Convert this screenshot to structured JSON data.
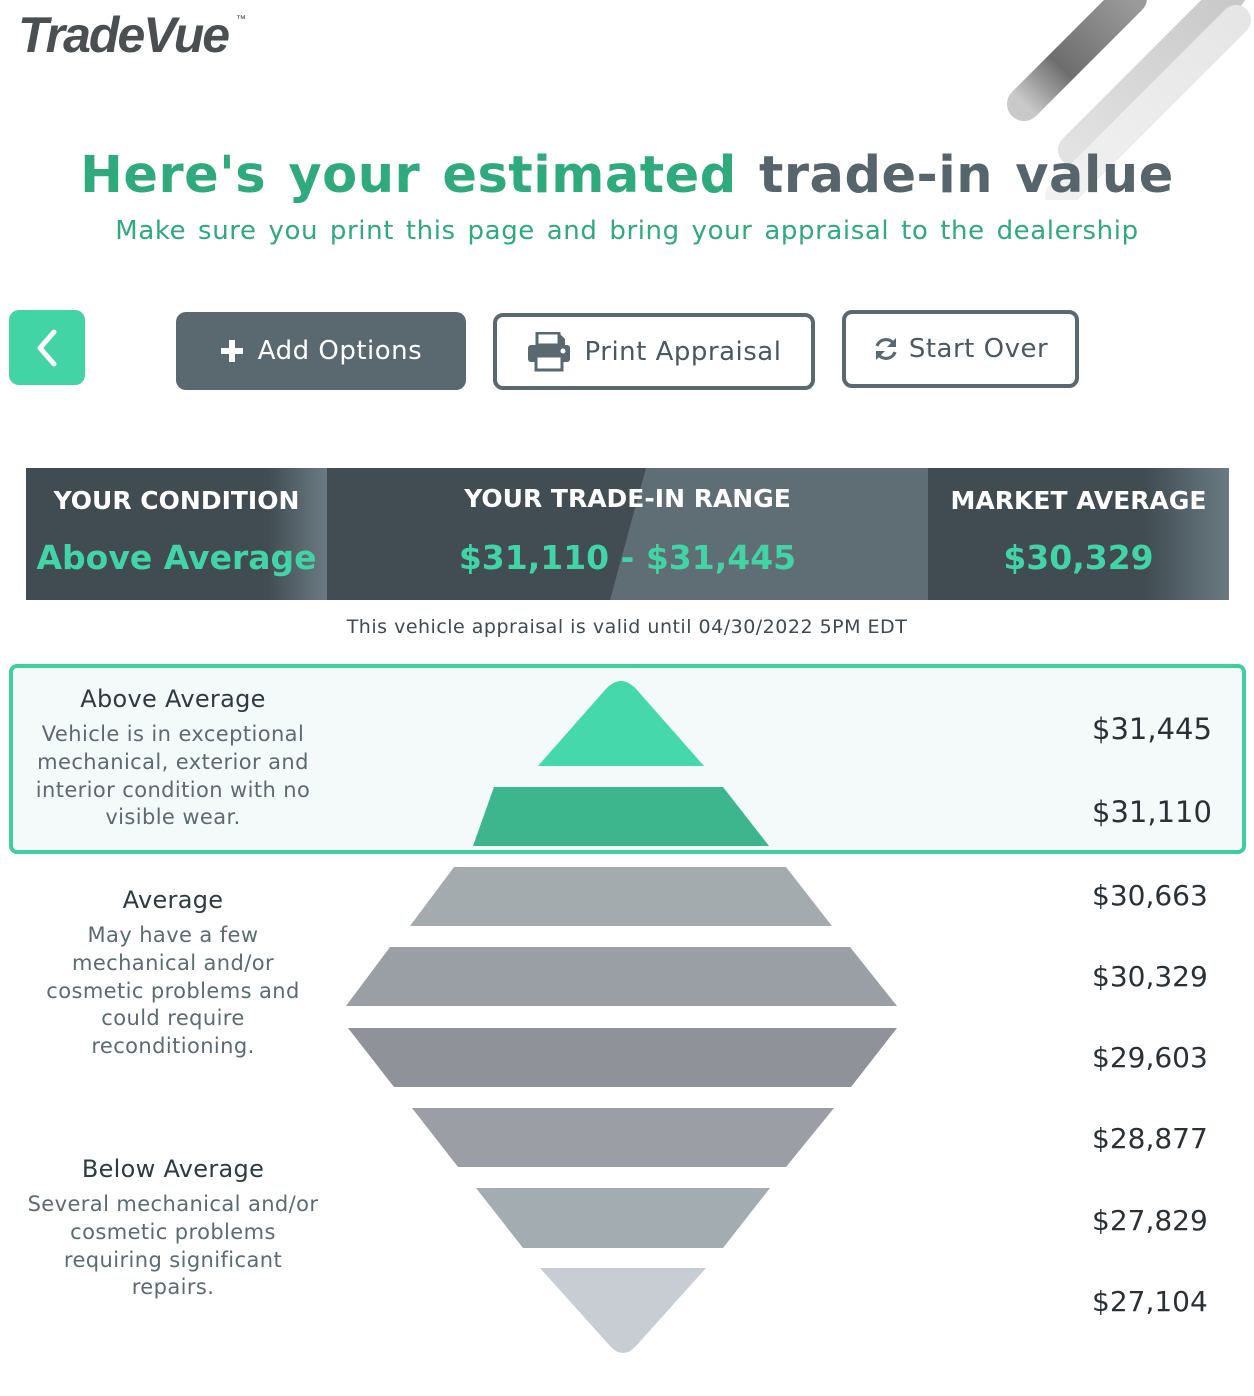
{
  "brand": {
    "logo_text": "TradeVue",
    "tm": "™"
  },
  "header": {
    "title_green": "Here's your estimated",
    "title_dark": "trade-in value",
    "subtitle": "Make sure you print this page and bring your appraisal to the dealership"
  },
  "actions": {
    "add_options": "Add Options",
    "print_appraisal": "Print Appraisal",
    "start_over": "Start Over"
  },
  "summary": {
    "condition_label": "YOUR CONDITION",
    "condition_value": "Above Average",
    "range_label": "YOUR TRADE-IN RANGE",
    "range_value": "$31,110 - $31,445",
    "market_label": "MARKET AVERAGE",
    "market_value": "$30,329"
  },
  "validity": "This vehicle appraisal is valid until 04/30/2022 5PM EDT",
  "conditions": [
    {
      "title": "Above Average",
      "description": "Vehicle is in exceptional mechanical, exterior and interior condition with no visible wear."
    },
    {
      "title": "Average",
      "description": "May have a few mechanical and/or cosmetic problems and could require reconditioning."
    },
    {
      "title": "Below Average",
      "description": "Several mechanical and/or cosmetic problems requiring significant repairs."
    }
  ],
  "price_scale": [
    "$31,445",
    "$31,110",
    "$30,663",
    "$30,329",
    "$29,603",
    "$28,877",
    "$27,829",
    "$27,104"
  ],
  "colors": {
    "accent": "#43d4a6",
    "accent_dark": "#2eaa7c",
    "slate": "#5a6870",
    "summary_bg": "#434f55"
  },
  "icons": [
    "chevron-left-icon",
    "plus-icon",
    "printer-icon",
    "refresh-icon"
  ]
}
